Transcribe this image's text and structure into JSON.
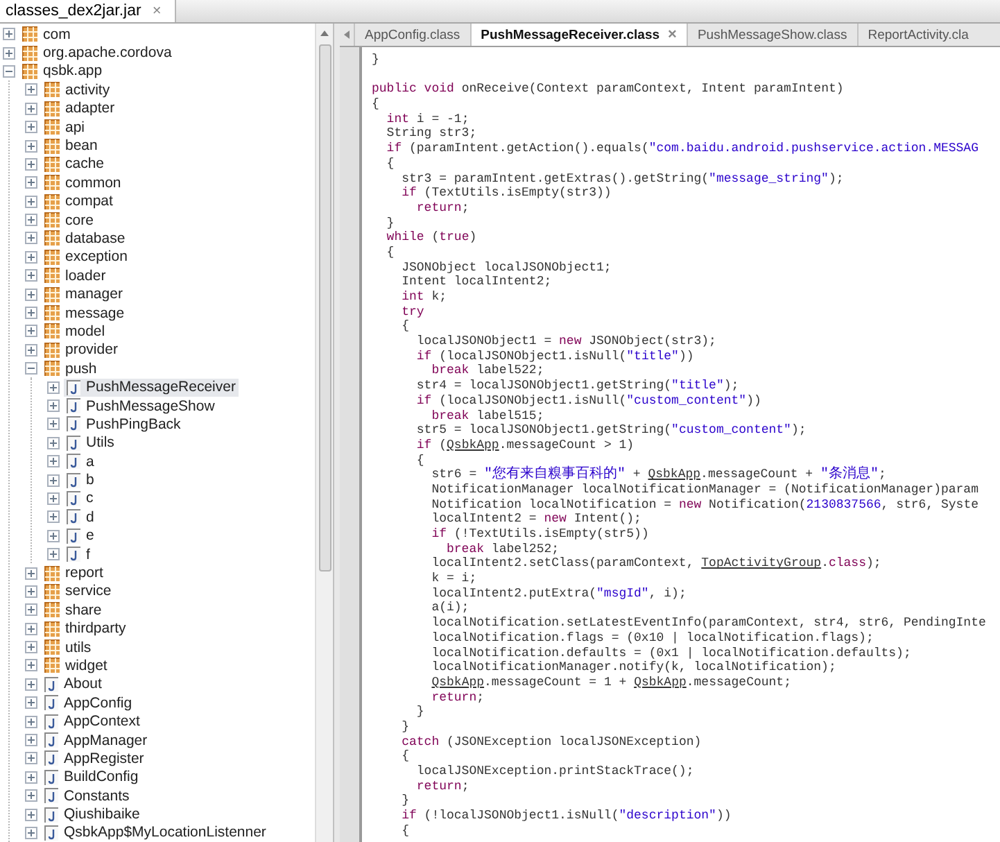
{
  "jar_tabs": [
    {
      "label": "classes_dex2jar.jar",
      "selected": true,
      "close": "×"
    }
  ],
  "tree": {
    "items": [
      {
        "label": "com",
        "kind": "package",
        "expanded": false,
        "selected": false
      },
      {
        "label": "org.apache.cordova",
        "kind": "package",
        "expanded": false,
        "selected": false
      },
      {
        "label": "qsbk.app",
        "kind": "package",
        "expanded": true,
        "selected": false,
        "children": [
          {
            "label": "activity",
            "kind": "package",
            "expanded": false,
            "selected": false
          },
          {
            "label": "adapter",
            "kind": "package",
            "expanded": false,
            "selected": false
          },
          {
            "label": "api",
            "kind": "package",
            "expanded": false,
            "selected": false
          },
          {
            "label": "bean",
            "kind": "package",
            "expanded": false,
            "selected": false
          },
          {
            "label": "cache",
            "kind": "package",
            "expanded": false,
            "selected": false
          },
          {
            "label": "common",
            "kind": "package",
            "expanded": false,
            "selected": false
          },
          {
            "label": "compat",
            "kind": "package",
            "expanded": false,
            "selected": false
          },
          {
            "label": "core",
            "kind": "package",
            "expanded": false,
            "selected": false
          },
          {
            "label": "database",
            "kind": "package",
            "expanded": false,
            "selected": false
          },
          {
            "label": "exception",
            "kind": "package",
            "expanded": false,
            "selected": false
          },
          {
            "label": "loader",
            "kind": "package",
            "expanded": false,
            "selected": false
          },
          {
            "label": "manager",
            "kind": "package",
            "expanded": false,
            "selected": false
          },
          {
            "label": "message",
            "kind": "package",
            "expanded": false,
            "selected": false
          },
          {
            "label": "model",
            "kind": "package",
            "expanded": false,
            "selected": false
          },
          {
            "label": "provider",
            "kind": "package",
            "expanded": false,
            "selected": false
          },
          {
            "label": "push",
            "kind": "package",
            "expanded": true,
            "selected": false,
            "children": [
              {
                "label": "PushMessageReceiver",
                "kind": "class",
                "expanded": false,
                "selected": true
              },
              {
                "label": "PushMessageShow",
                "kind": "class",
                "expanded": false,
                "selected": false
              },
              {
                "label": "PushPingBack",
                "kind": "class",
                "expanded": false,
                "selected": false
              },
              {
                "label": "Utils",
                "kind": "class",
                "expanded": false,
                "selected": false
              },
              {
                "label": "a",
                "kind": "class",
                "expanded": false,
                "selected": false
              },
              {
                "label": "b",
                "kind": "class",
                "expanded": false,
                "selected": false
              },
              {
                "label": "c",
                "kind": "class",
                "expanded": false,
                "selected": false
              },
              {
                "label": "d",
                "kind": "class",
                "expanded": false,
                "selected": false
              },
              {
                "label": "e",
                "kind": "class",
                "expanded": false,
                "selected": false
              },
              {
                "label": "f",
                "kind": "class",
                "expanded": false,
                "selected": false
              }
            ]
          },
          {
            "label": "report",
            "kind": "package",
            "expanded": false,
            "selected": false
          },
          {
            "label": "service",
            "kind": "package",
            "expanded": false,
            "selected": false
          },
          {
            "label": "share",
            "kind": "package",
            "expanded": false,
            "selected": false
          },
          {
            "label": "thirdparty",
            "kind": "package",
            "expanded": false,
            "selected": false
          },
          {
            "label": "utils",
            "kind": "package",
            "expanded": false,
            "selected": false
          },
          {
            "label": "widget",
            "kind": "package",
            "expanded": false,
            "selected": false
          },
          {
            "label": "About",
            "kind": "class",
            "expanded": false,
            "selected": false
          },
          {
            "label": "AppConfig",
            "kind": "class",
            "expanded": false,
            "selected": false
          },
          {
            "label": "AppContext",
            "kind": "class",
            "expanded": false,
            "selected": false
          },
          {
            "label": "AppManager",
            "kind": "class",
            "expanded": false,
            "selected": false
          },
          {
            "label": "AppRegister",
            "kind": "class",
            "expanded": false,
            "selected": false
          },
          {
            "label": "BuildConfig",
            "kind": "class",
            "expanded": false,
            "selected": false
          },
          {
            "label": "Constants",
            "kind": "class",
            "expanded": false,
            "selected": false
          },
          {
            "label": "Qiushibaike",
            "kind": "class",
            "expanded": false,
            "selected": false
          },
          {
            "label": "QsbkApp$MyLocationListenner",
            "kind": "class",
            "expanded": false,
            "selected": false
          }
        ]
      }
    ]
  },
  "editor": {
    "tabs": [
      {
        "label": "AppConfig.class",
        "selected": false
      },
      {
        "label": "PushMessageReceiver.class",
        "selected": true,
        "close": "×"
      },
      {
        "label": "PushMessageShow.class",
        "selected": false
      },
      {
        "label": "ReportActivity.cla",
        "selected": false
      }
    ],
    "lines": [
      {
        "segments": [
          {
            "kind": "plain",
            "text": "}"
          }
        ]
      },
      {
        "blank_before": true,
        "segments": [
          {
            "kind": "keyword",
            "text": "public void"
          },
          {
            "kind": "plain",
            "text": " onReceive(Context paramContext, Intent paramIntent)"
          }
        ]
      },
      {
        "segments": [
          {
            "kind": "plain",
            "text": "{"
          }
        ]
      },
      {
        "segments": [
          {
            "kind": "keyword",
            "text": "  int"
          },
          {
            "kind": "plain",
            "text": " i = -1;"
          }
        ]
      },
      {
        "segments": [
          {
            "kind": "plain",
            "text": "  String str3;"
          }
        ]
      },
      {
        "segments": [
          {
            "kind": "keyword",
            "text": "  if"
          },
          {
            "kind": "plain",
            "text": " (paramIntent.getAction().equals("
          },
          {
            "kind": "string",
            "text": "\"com.baidu.android.pushservice.action.MESSAG"
          }
        ]
      },
      {
        "segments": [
          {
            "kind": "plain",
            "text": "  {"
          }
        ]
      },
      {
        "segments": [
          {
            "kind": "plain",
            "text": "    str3 = paramIntent.getExtras().getString("
          },
          {
            "kind": "string",
            "text": "\"message_string\""
          },
          {
            "kind": "plain",
            "text": ");"
          }
        ]
      },
      {
        "segments": [
          {
            "kind": "keyword",
            "text": "    if"
          },
          {
            "kind": "plain",
            "text": " (TextUtils.isEmpty(str3))"
          }
        ]
      },
      {
        "segments": [
          {
            "kind": "keyword",
            "text": "      return"
          },
          {
            "kind": "plain",
            "text": ";"
          }
        ]
      },
      {
        "segments": [
          {
            "kind": "plain",
            "text": "  }"
          }
        ]
      },
      {
        "segments": [
          {
            "kind": "keyword",
            "text": "  while"
          },
          {
            "kind": "plain",
            "text": " ("
          },
          {
            "kind": "keyword",
            "text": "true"
          },
          {
            "kind": "plain",
            "text": ")"
          }
        ]
      },
      {
        "segments": [
          {
            "kind": "plain",
            "text": "  {"
          }
        ]
      },
      {
        "segments": [
          {
            "kind": "plain",
            "text": "    JSONObject localJSONObject1;"
          }
        ]
      },
      {
        "segments": [
          {
            "kind": "plain",
            "text": "    Intent localIntent2;"
          }
        ]
      },
      {
        "segments": [
          {
            "kind": "keyword",
            "text": "    int"
          },
          {
            "kind": "plain",
            "text": " k;"
          }
        ]
      },
      {
        "segments": [
          {
            "kind": "keyword",
            "text": "    try"
          }
        ]
      },
      {
        "segments": [
          {
            "kind": "plain",
            "text": "    {"
          }
        ]
      },
      {
        "segments": [
          {
            "kind": "plain",
            "text": "      localJSONObject1 = "
          },
          {
            "kind": "keyword",
            "text": "new"
          },
          {
            "kind": "plain",
            "text": " JSONObject(str3);"
          }
        ]
      },
      {
        "segments": [
          {
            "kind": "keyword",
            "text": "      if"
          },
          {
            "kind": "plain",
            "text": " (localJSONObject1.isNull("
          },
          {
            "kind": "string",
            "text": "\"title\""
          },
          {
            "kind": "plain",
            "text": "))"
          }
        ]
      },
      {
        "segments": [
          {
            "kind": "keyword",
            "text": "        break"
          },
          {
            "kind": "plain",
            "text": " label522;"
          }
        ]
      },
      {
        "segments": [
          {
            "kind": "plain",
            "text": "      str4 = localJSONObject1.getString("
          },
          {
            "kind": "string",
            "text": "\"title\""
          },
          {
            "kind": "plain",
            "text": ");"
          }
        ]
      },
      {
        "segments": [
          {
            "kind": "keyword",
            "text": "      if"
          },
          {
            "kind": "plain",
            "text": " (localJSONObject1.isNull("
          },
          {
            "kind": "string",
            "text": "\"custom_content\""
          },
          {
            "kind": "plain",
            "text": "))"
          }
        ]
      },
      {
        "segments": [
          {
            "kind": "keyword",
            "text": "        break"
          },
          {
            "kind": "plain",
            "text": " label515;"
          }
        ]
      },
      {
        "segments": [
          {
            "kind": "plain",
            "text": "      str5 = localJSONObject1.getString("
          },
          {
            "kind": "string",
            "text": "\"custom_content\""
          },
          {
            "kind": "plain",
            "text": ");"
          }
        ]
      },
      {
        "segments": [
          {
            "kind": "keyword",
            "text": "      if"
          },
          {
            "kind": "plain",
            "text": " ("
          },
          {
            "kind": "link",
            "text": "QsbkApp"
          },
          {
            "kind": "plain",
            "text": ".messageCount > 1)"
          }
        ]
      },
      {
        "segments": [
          {
            "kind": "plain",
            "text": "      {"
          }
        ]
      },
      {
        "segments": [
          {
            "kind": "plain",
            "text": "        str6 = "
          },
          {
            "kind": "string",
            "text": "\"您有来自糗事百科的\""
          },
          {
            "kind": "plain",
            "text": " + "
          },
          {
            "kind": "link",
            "text": "QsbkApp"
          },
          {
            "kind": "plain",
            "text": ".messageCount + "
          },
          {
            "kind": "string",
            "text": "\"条消息\""
          },
          {
            "kind": "plain",
            "text": ";"
          }
        ]
      },
      {
        "segments": [
          {
            "kind": "plain",
            "text": "        NotificationManager localNotificationManager = (NotificationManager)param"
          }
        ]
      },
      {
        "segments": [
          {
            "kind": "plain",
            "text": "        Notification localNotification = "
          },
          {
            "kind": "keyword",
            "text": "new"
          },
          {
            "kind": "plain",
            "text": " Notification("
          },
          {
            "kind": "number",
            "text": "2130837566"
          },
          {
            "kind": "plain",
            "text": ", str6, Syste"
          }
        ]
      },
      {
        "segments": [
          {
            "kind": "plain",
            "text": "        localIntent2 = "
          },
          {
            "kind": "keyword",
            "text": "new"
          },
          {
            "kind": "plain",
            "text": " Intent();"
          }
        ]
      },
      {
        "segments": [
          {
            "kind": "keyword",
            "text": "        if"
          },
          {
            "kind": "plain",
            "text": " (!TextUtils.isEmpty(str5))"
          }
        ]
      },
      {
        "segments": [
          {
            "kind": "keyword",
            "text": "          break"
          },
          {
            "kind": "plain",
            "text": " label252;"
          }
        ]
      },
      {
        "segments": [
          {
            "kind": "plain",
            "text": "        localIntent2.setClass(paramContext, "
          },
          {
            "kind": "link",
            "text": "TopActivityGroup"
          },
          {
            "kind": "plain",
            "text": "."
          },
          {
            "kind": "keyword",
            "text": "class"
          },
          {
            "kind": "plain",
            "text": ");"
          }
        ]
      },
      {
        "segments": [
          {
            "kind": "plain",
            "text": "        k = i;"
          }
        ]
      },
      {
        "segments": [
          {
            "kind": "plain",
            "text": "        localIntent2.putExtra("
          },
          {
            "kind": "string",
            "text": "\"msgId\""
          },
          {
            "kind": "plain",
            "text": ", i);"
          }
        ]
      },
      {
        "segments": [
          {
            "kind": "plain",
            "text": "        a(i);"
          }
        ]
      },
      {
        "segments": [
          {
            "kind": "plain",
            "text": "        localNotification.setLatestEventInfo(paramContext, str4, str6, PendingInte"
          }
        ]
      },
      {
        "segments": [
          {
            "kind": "plain",
            "text": "        localNotification.flags = (0x10 | localNotification.flags);"
          }
        ]
      },
      {
        "segments": [
          {
            "kind": "plain",
            "text": "        localNotification.defaults = (0x1 | localNotification.defaults);"
          }
        ]
      },
      {
        "segments": [
          {
            "kind": "plain",
            "text": "        localNotificationManager.notify(k, localNotification);"
          }
        ]
      },
      {
        "segments": [
          {
            "kind": "link",
            "text": "        QsbkApp"
          },
          {
            "kind": "plain",
            "text": ".messageCount = 1 + "
          },
          {
            "kind": "link",
            "text": "QsbkApp"
          },
          {
            "kind": "plain",
            "text": ".messageCount;"
          }
        ]
      },
      {
        "segments": [
          {
            "kind": "keyword",
            "text": "        return"
          },
          {
            "kind": "plain",
            "text": ";"
          }
        ]
      },
      {
        "segments": [
          {
            "kind": "plain",
            "text": "      }"
          }
        ]
      },
      {
        "segments": [
          {
            "kind": "plain",
            "text": "    }"
          }
        ]
      },
      {
        "segments": [
          {
            "kind": "keyword",
            "text": "    catch"
          },
          {
            "kind": "plain",
            "text": " (JSONException localJSONException)"
          }
        ]
      },
      {
        "segments": [
          {
            "kind": "plain",
            "text": "    {"
          }
        ]
      },
      {
        "segments": [
          {
            "kind": "plain",
            "text": "      localJSONException.printStackTrace();"
          }
        ]
      },
      {
        "segments": [
          {
            "kind": "keyword",
            "text": "      return"
          },
          {
            "kind": "plain",
            "text": ";"
          }
        ]
      },
      {
        "segments": [
          {
            "kind": "plain",
            "text": "    }"
          }
        ]
      },
      {
        "segments": [
          {
            "kind": "keyword",
            "text": "    if"
          },
          {
            "kind": "plain",
            "text": " (!localJSONObject1.isNull("
          },
          {
            "kind": "string",
            "text": "\"description\""
          },
          {
            "kind": "plain",
            "text": "))"
          }
        ]
      },
      {
        "segments": [
          {
            "kind": "plain",
            "text": "    {"
          }
        ]
      }
    ]
  }
}
